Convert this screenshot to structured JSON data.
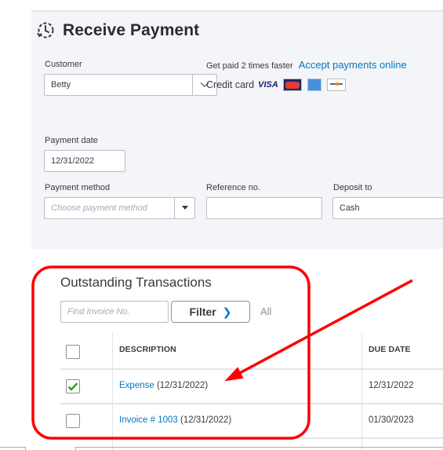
{
  "page": {
    "title": "Receive Payment",
    "title_icon": "clock-history-icon"
  },
  "customer": {
    "label": "Customer",
    "value": "Betty"
  },
  "promo": {
    "text": "Get paid 2 times faster",
    "link": "Accept payments online",
    "credit_card_label": "Credit card",
    "cards": [
      "VISA",
      "MasterCard",
      "American Express",
      "Discover"
    ]
  },
  "payment_date": {
    "label": "Payment date",
    "value": "12/31/2022"
  },
  "payment_method": {
    "label": "Payment method",
    "placeholder": "Choose payment method",
    "value": ""
  },
  "reference_no": {
    "label": "Reference no.",
    "value": ""
  },
  "deposit_to": {
    "label": "Deposit to",
    "value": "Cash"
  },
  "outstanding": {
    "title": "Outstanding Transactions",
    "find_placeholder": "Find Invoice No.",
    "filter_label": "Filter",
    "all_label": "All",
    "columns": [
      "DESCRIPTION",
      "DUE DATE"
    ],
    "rows": [
      {
        "checked": true,
        "link": "Expense",
        "date_suffix": " (12/31/2022)",
        "due_date": "12/31/2022"
      },
      {
        "checked": false,
        "link": "Invoice # 1003",
        "date_suffix": " (12/31/2022)",
        "due_date": "01/30/2023"
      }
    ]
  },
  "colors": {
    "accent_link": "#0077c5",
    "annotation_red": "#ff0000",
    "check_green": "#2ca01c",
    "panel_bg": "#f4f5f8"
  }
}
